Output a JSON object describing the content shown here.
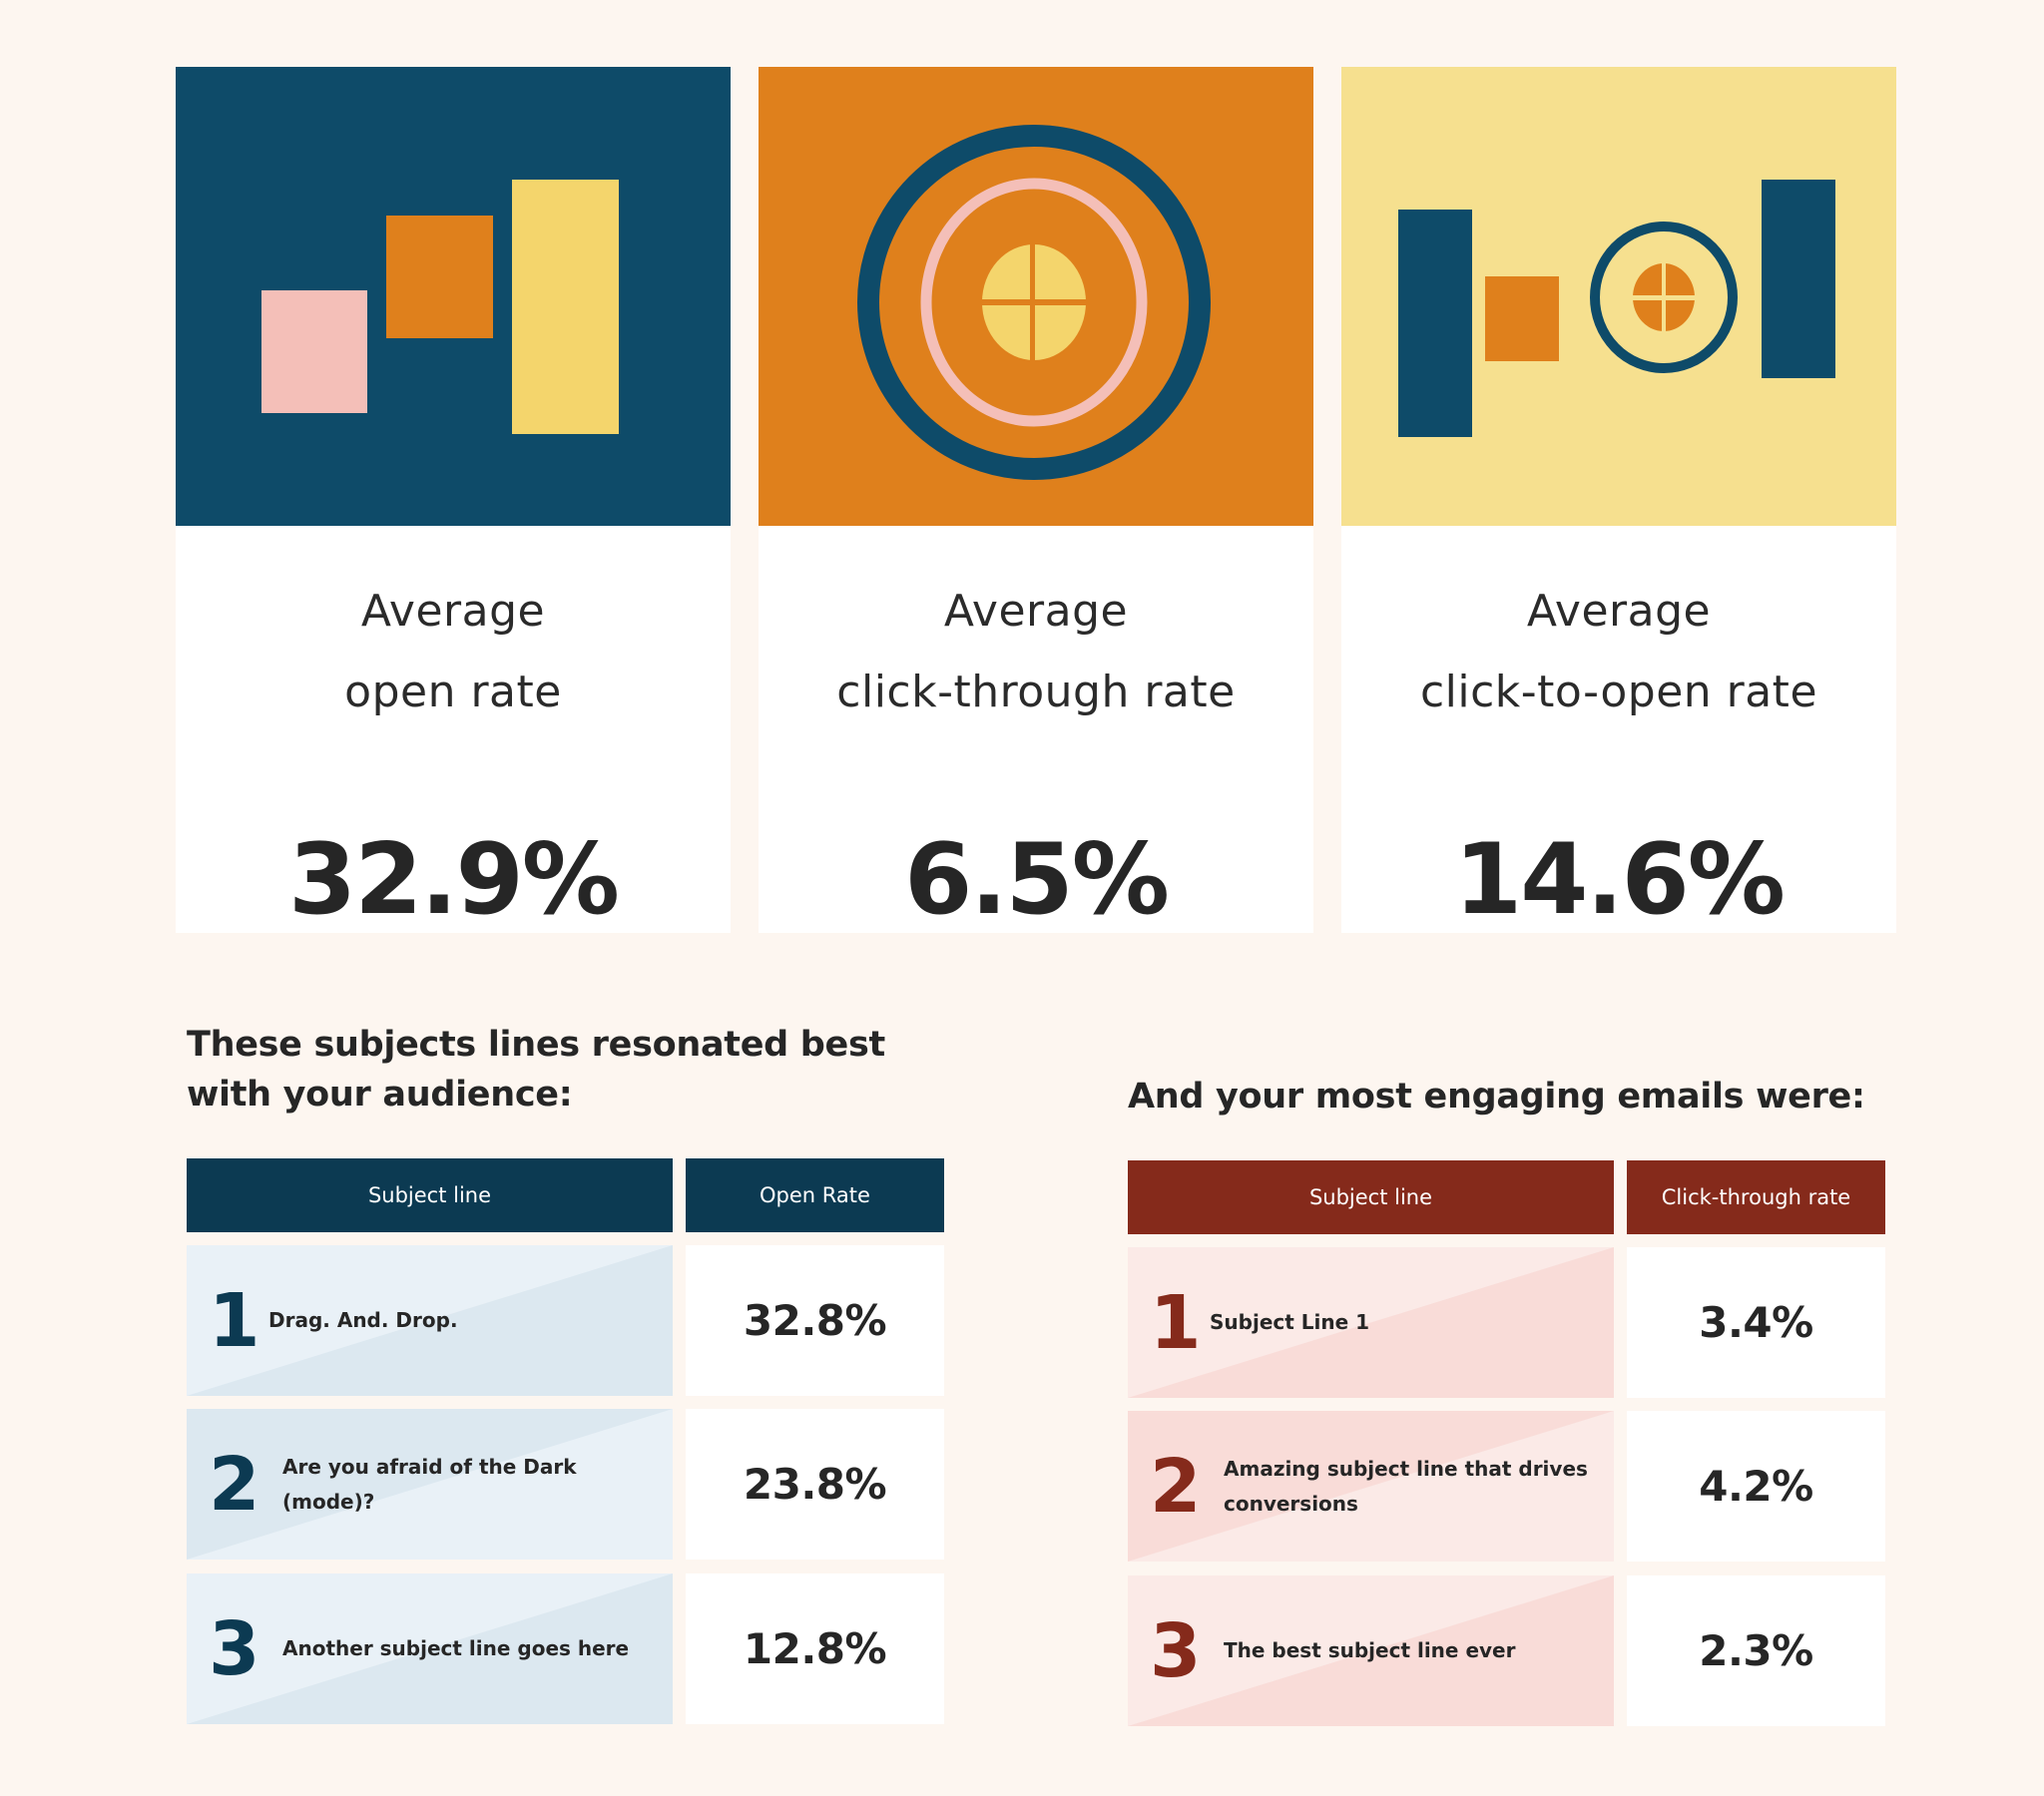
{
  "colors": {
    "background": "#fdf6f0",
    "navy": "#0e4b69",
    "orange": "#df801c",
    "yellow": "#f4d56c",
    "pale_yellow": "#f6e08f",
    "pink": "#f4bfb8",
    "table_navy": "#0c3a52",
    "table_maroon": "#852a1b",
    "blue_light": "#e9f1f7",
    "blue_dark": "#dce8f0",
    "pink_light": "#fbeae7",
    "pink_dark": "#f9dcd8"
  },
  "stats": [
    {
      "label_line1": "Average",
      "label_line2": "open rate",
      "value": "32.9%",
      "art": "bars-illustration"
    },
    {
      "label_line1": "Average",
      "label_line2": "click-through rate",
      "value": "6.5%",
      "art": "target-illustration"
    },
    {
      "label_line1": "Average",
      "label_line2": "click-to-open rate",
      "value": "14.6%",
      "art": "bars-and-target-illustration"
    }
  ],
  "subject_lines": {
    "heading": "These subjects lines resonated best with your audience:",
    "columns": [
      "Subject line",
      "Open Rate"
    ],
    "rows": [
      {
        "rank": "1",
        "subject": "Drag. And. Drop.",
        "rate": "32.8%"
      },
      {
        "rank": "2",
        "subject": "Are you afraid of the Dark (mode)?",
        "rate": "23.8%"
      },
      {
        "rank": "3",
        "subject": "Another subject line goes here",
        "rate": "12.8%"
      }
    ]
  },
  "engaging_emails": {
    "heading": "And your most engaging emails were:",
    "columns": [
      "Subject line",
      "Click-through rate"
    ],
    "rows": [
      {
        "rank": "1",
        "subject": "Subject Line 1",
        "rate": "3.4%"
      },
      {
        "rank": "2",
        "subject": "Amazing subject line that drives conversions",
        "rate": "4.2%"
      },
      {
        "rank": "3",
        "subject": "The best subject line ever",
        "rate": "2.3%"
      }
    ]
  }
}
